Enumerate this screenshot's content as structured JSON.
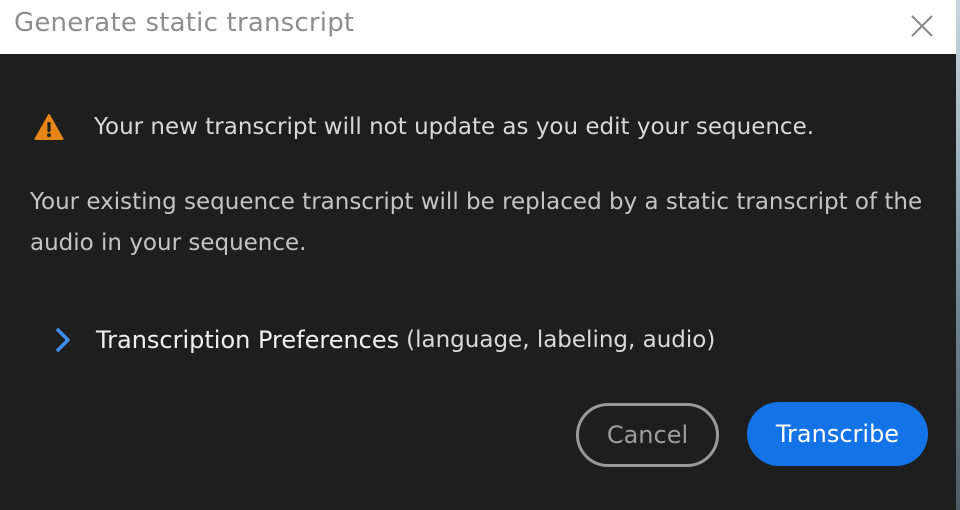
{
  "dialog": {
    "title": "Generate static transcript",
    "warning": "Your new transcript will not update as you edit your sequence.",
    "description": "Your existing sequence transcript will be replaced by a static transcript of the audio in your sequence.",
    "preferences": {
      "title": "Transcription Preferences",
      "subtitle": "(language, labeling, audio)"
    },
    "buttons": {
      "cancel": "Cancel",
      "primary": "Transcribe"
    }
  },
  "icons": {
    "close": "close-icon",
    "warning": "warning-icon",
    "chevron": "chevron-right-icon"
  },
  "colors": {
    "accent": "#1473e6",
    "warning": "#e68619",
    "background": "#1e1e1e",
    "titlebar": "#ffffff"
  }
}
